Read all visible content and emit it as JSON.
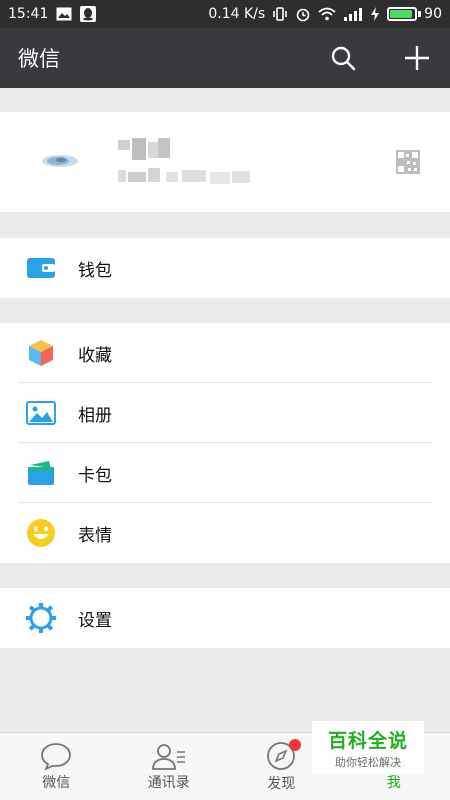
{
  "status_bar": {
    "time": "15:41",
    "speed": "0.14 K/s",
    "battery": "90"
  },
  "header": {
    "title": "微信",
    "search_icon": "search-icon",
    "add_icon": "plus-icon"
  },
  "menu": {
    "wallet": "钱包",
    "favorites": "收藏",
    "album": "相册",
    "cards": "卡包",
    "stickers": "表情",
    "settings": "设置"
  },
  "tabs": [
    {
      "label": "微信",
      "icon": "chat-icon"
    },
    {
      "label": "通讯录",
      "icon": "contacts-icon"
    },
    {
      "label": "发现",
      "icon": "compass-icon"
    },
    {
      "label": "我",
      "icon": "me-icon"
    }
  ],
  "watermark": {
    "title": "百科全说",
    "subtitle": "助你轻松解决"
  },
  "colors": {
    "accent": "#1aad19",
    "titlebar": "#393a3e",
    "badge": "#f43530"
  }
}
